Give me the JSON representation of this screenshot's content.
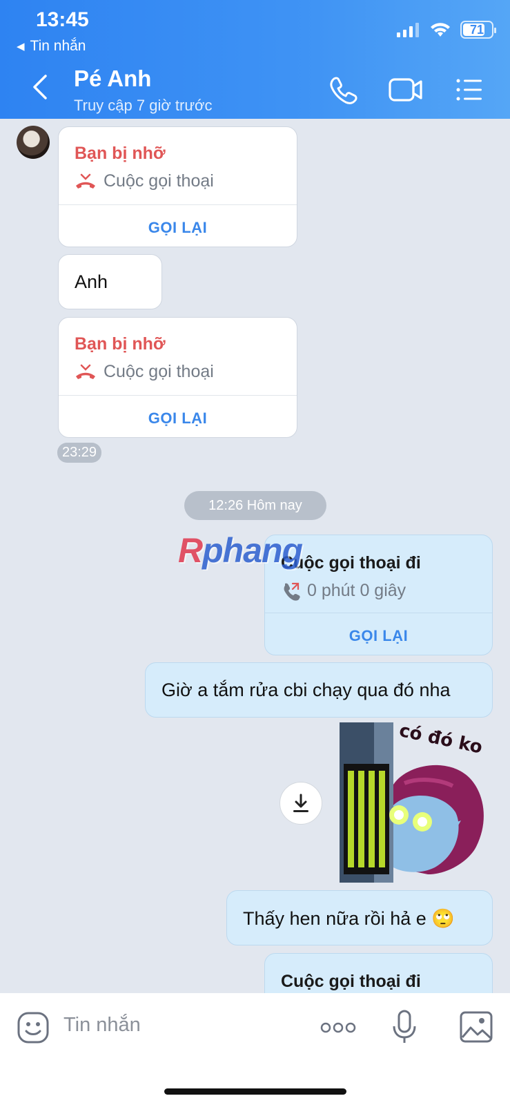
{
  "status_bar": {
    "time": "13:45",
    "back_app": "Tin nhắn",
    "battery": "71"
  },
  "header": {
    "name": "Pé Anh",
    "status": "Truy cập 7 giờ trước"
  },
  "messages": {
    "missed1": {
      "title": "Bạn bị nhỡ",
      "subtitle": "Cuộc gọi thoại",
      "action": "GỌI LẠI"
    },
    "text1": "Anh",
    "missed2": {
      "title": "Bạn bị nhỡ",
      "subtitle": "Cuộc gọi thoại",
      "action": "GỌI LẠI"
    },
    "time1": "23:29",
    "date_separator": "12:26 Hôm nay",
    "outgoing1": {
      "title": "Cuộc gọi thoại đi",
      "subtitle": "0 phút 0 giây",
      "action": "GỌI LẠI"
    },
    "text2": "Giờ a tắm rửa cbi chạy qua đó nha",
    "sticker_caption": "có đó ko",
    "text3": "Thấy hen nữa rồi hả e 🙄",
    "outgoing2": {
      "title": "Cuộc gọi thoại đi"
    }
  },
  "watermark": {
    "part1": "R",
    "part2": "phang"
  },
  "composer": {
    "placeholder": "Tin nhắn"
  },
  "colors": {
    "header_start": "#2e83f2",
    "missed_red": "#e05656",
    "action_blue": "#3a87ea",
    "outgoing_bubble": "#d6ecfb"
  }
}
